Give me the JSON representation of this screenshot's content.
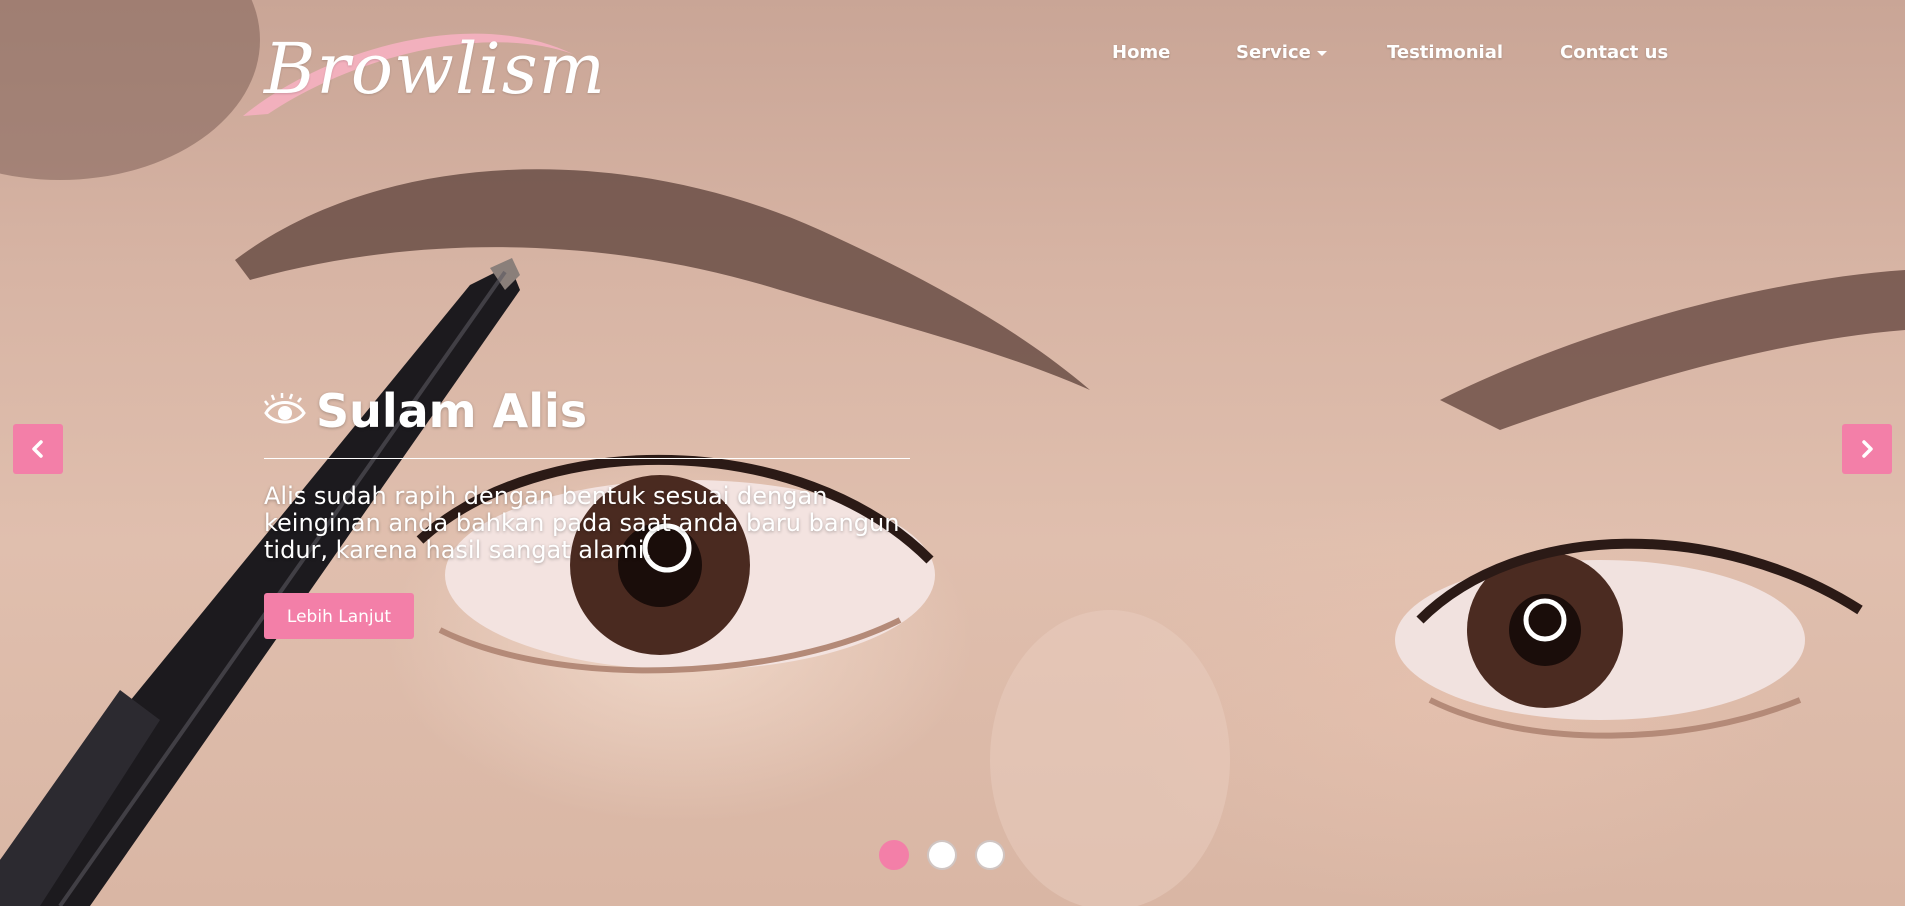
{
  "brand": {
    "logo_text": "Browlism",
    "accent_color": "#f37fa8",
    "swoosh_color": "#f2b0bd"
  },
  "nav": {
    "items": [
      {
        "label": "Home"
      },
      {
        "label": "Service",
        "has_dropdown": true
      },
      {
        "label": "Testimonial"
      },
      {
        "label": "Contact us"
      }
    ]
  },
  "hero": {
    "icon": "eye-icon",
    "title": "Sulam Alis",
    "description": "Alis sudah rapih dengan bentuk sesuai dengan keinginan anda bahkan pada saat anda baru bangun tidur, karena hasil sangat alami.",
    "button_label": "Lebih Lanjut"
  },
  "carousel": {
    "prev_icon": "chevron-left-icon",
    "next_icon": "chevron-right-icon",
    "slide_count": 3,
    "active_index": 0
  }
}
